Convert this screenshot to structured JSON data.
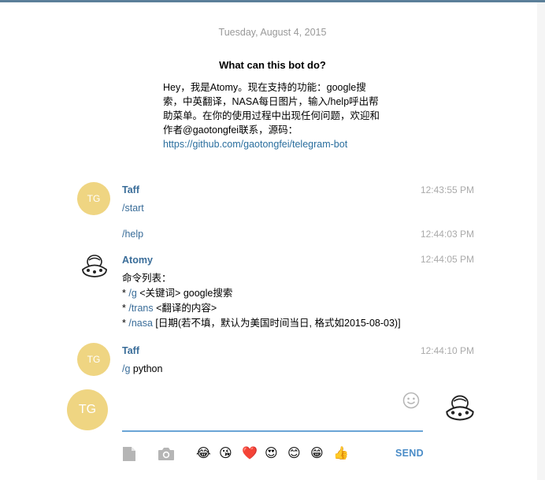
{
  "date_label": "Tuesday, August 4, 2015",
  "bot_info": {
    "title": "What can this bot do?",
    "text_before_link": "Hey，我是Atomy。现在支持的功能：google搜索，中英翻译，NASA每日图片，输入/help呼出帮助菜单。在你的使用过程中出现任何问题，欢迎和作者@gaotongfei联系，源码：",
    "link": "https://github.com/gaotongfei/telegram-bot"
  },
  "messages": [
    {
      "sender": "Taff",
      "avatar_initials": "TG",
      "time": "12:43:55 PM",
      "text": "/start"
    },
    {
      "time": "12:44:03 PM",
      "text": "/help"
    },
    {
      "sender": "Atomy",
      "time": "12:44:05 PM",
      "line1": "命令列表：",
      "line2_prefix": "* ",
      "line2_cmd": "/g",
      "line2_rest": " <关键词> google搜索",
      "line3_prefix": "* ",
      "line3_cmd": "/trans",
      "line3_rest": " <翻译的内容>",
      "line4_prefix": "* ",
      "line4_cmd": "/nasa",
      "line4_rest": " [日期(若不填，默认为美国时间当日, 格式如2015-08-03)]"
    },
    {
      "sender": "Taff",
      "avatar_initials": "TG",
      "time": "12:44:10 PM",
      "cmd": "/g",
      "rest": " python"
    }
  ],
  "composer": {
    "avatar_initials": "TG",
    "value": "",
    "send_label": "SEND",
    "emojis": [
      "😂",
      "😘",
      "❤️",
      "😍",
      "😊",
      "😁",
      "👍"
    ]
  },
  "icons": {
    "emoji_toggle": "smiley-icon",
    "attach": "document-icon",
    "photo": "camera-icon",
    "bot_avatar": "robot-icon"
  },
  "colors": {
    "accent": "#3a6d99",
    "avatar": "#efd582",
    "link": "#2a6e9e",
    "input_underline": "#6aa5d6"
  }
}
